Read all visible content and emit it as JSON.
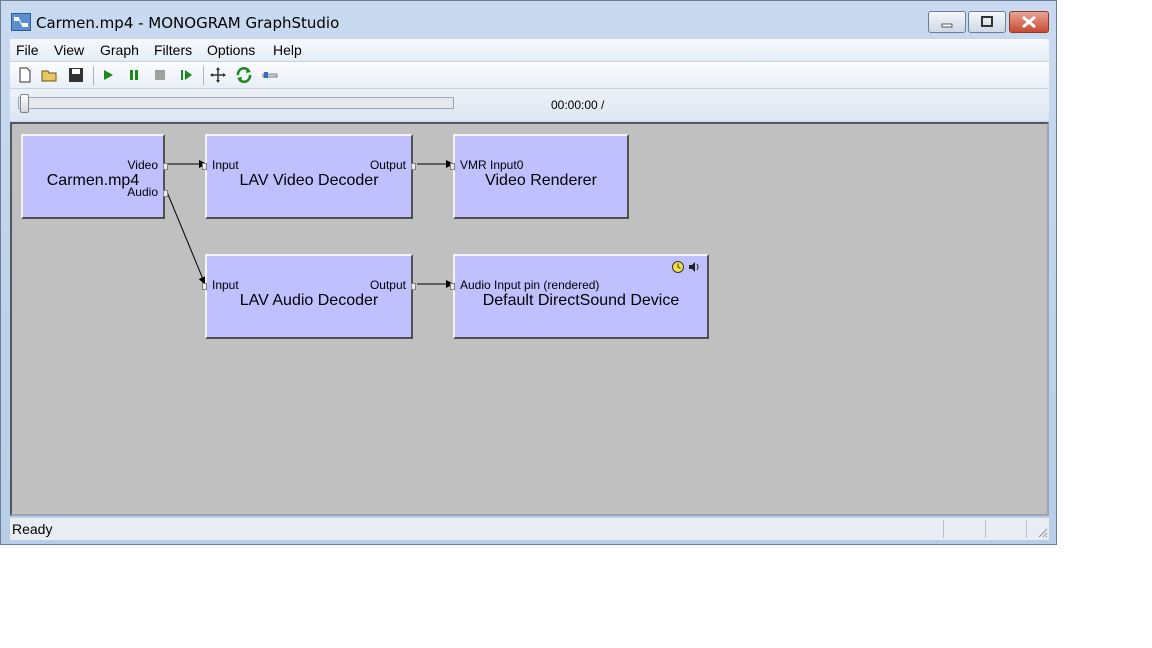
{
  "window": {
    "title": "Carmen.mp4 - MONOGRAM GraphStudio",
    "controls": {
      "minimize": "minimize-icon",
      "maximize": "restore-icon",
      "close": "close-icon"
    }
  },
  "menu": {
    "items": [
      {
        "label": "File"
      },
      {
        "label": "View"
      },
      {
        "label": "Graph"
      },
      {
        "label": "Filters"
      },
      {
        "label": "Options"
      },
      {
        "label": "Help"
      }
    ]
  },
  "toolbar": {
    "buttons": [
      "new-icon",
      "open-icon",
      "save-icon",
      "play-icon",
      "pause-icon",
      "stop-icon",
      "step-icon",
      "arrange-icon",
      "refresh-icon",
      "seek-icon"
    ]
  },
  "seek": {
    "time": "00:00:00 /",
    "progress": 0
  },
  "graph": {
    "filters": {
      "source": {
        "name": "Carmen.mp4",
        "pins": {
          "video": "Video",
          "audio": "Audio"
        }
      },
      "video_decoder": {
        "name": "LAV Video Decoder",
        "pins": {
          "input": "Input",
          "output": "Output"
        }
      },
      "video_renderer": {
        "name": "Video Renderer",
        "pins": {
          "input": "VMR Input0"
        }
      },
      "audio_decoder": {
        "name": "LAV Audio Decoder",
        "pins": {
          "input": "Input",
          "output": "Output"
        }
      },
      "audio_renderer": {
        "name": "Default DirectSound Device",
        "pins": {
          "input": "Audio Input pin (rendered)"
        },
        "icons": [
          "clock-icon",
          "speaker-icon"
        ]
      }
    }
  },
  "status": {
    "text": "Ready"
  },
  "colors": {
    "filter_fill": "#c0c0ff",
    "canvas": "#c0c0c0"
  }
}
